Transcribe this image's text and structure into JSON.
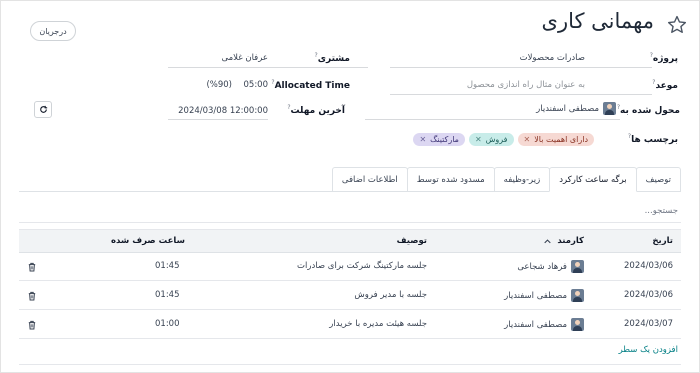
{
  "header": {
    "title": "مهمانی کاری",
    "stage_button": "درجریان"
  },
  "fields": {
    "project_label": "پروژه",
    "project_value": "صادرات محصولات",
    "customer_label": "مشتری",
    "customer_value": "عرفان غلامی",
    "deadline_label": "موعد",
    "deadline_value": "به عنوان مثال راه اندازی محصول",
    "allocated_label": "Allocated Time",
    "allocated_value": "05:00",
    "allocated_percent": "(%90)",
    "assignee_label": "محول شده به",
    "assignee_value": "مصطفی اسفندیار",
    "last_deadline_label": "آخرین مهلت",
    "last_deadline_value": "2024/03/08 12:00:00",
    "tags_label": "برچسب ها"
  },
  "tags": [
    {
      "label": "دارای اهمیت بالا",
      "bg": "#f6d9d3",
      "fg": "#8a3324"
    },
    {
      "label": "فروش",
      "bg": "#c8ece9",
      "fg": "#1d5f5a"
    },
    {
      "label": "مارکتینگ",
      "bg": "#dcd7f2",
      "fg": "#3f3577"
    }
  ],
  "tabs": [
    {
      "label": "توصیف",
      "active": false
    },
    {
      "label": "برگه ساعت کارکرد",
      "active": true
    },
    {
      "label": "زیر-وظیفه",
      "active": false
    },
    {
      "label": "مسدود شده توسط",
      "active": false
    },
    {
      "label": "اطلاعات اضافی",
      "active": false
    }
  ],
  "search": {
    "placeholder": "جستجو..."
  },
  "table": {
    "col_date": "تاریخ",
    "col_employee": "کارمند",
    "col_description": "توصیف",
    "col_hours": "ساعت صرف شده",
    "rows": [
      {
        "date": "2024/03/06",
        "employee": "فرهاد شجاعی",
        "description": "جلسه مارکتینگ شرکت برای صادرات",
        "hours": "01:45"
      },
      {
        "date": "2024/03/06",
        "employee": "مصطفی اسفندیار",
        "description": "جلسه با مدیر فروش",
        "hours": "01:45"
      },
      {
        "date": "2024/03/07",
        "employee": "مصطفی اسفندیار",
        "description": "جلسه هیئت مدیره با خریدار",
        "hours": "01:00"
      }
    ],
    "add_line": "افزودن یک سطر"
  },
  "colors": {
    "accent": "#017e84"
  }
}
